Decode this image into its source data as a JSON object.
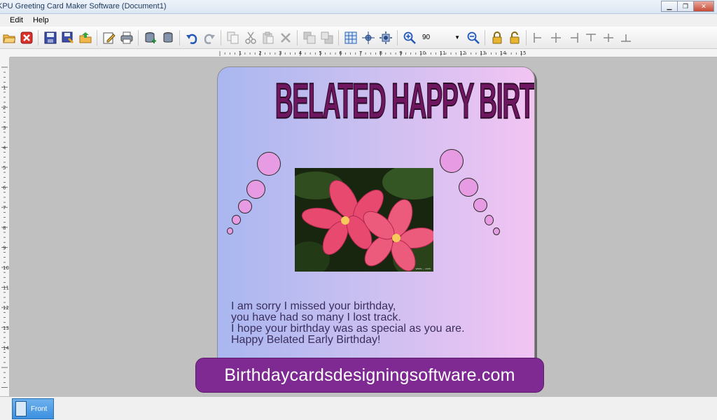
{
  "window": {
    "title": "KPU Greeting Card Maker Software  (Document1)"
  },
  "menu": {
    "items": [
      {
        "label": "Edit"
      },
      {
        "label": "Help"
      }
    ]
  },
  "toolbar": {
    "zoom_value": "90",
    "icons": [
      "open-folder-icon",
      "close-document-icon",
      "save-icon",
      "save-as-icon",
      "export-icon",
      "edit-icon",
      "print-icon",
      "database-add-icon",
      "database-icon",
      "undo-icon",
      "redo-icon",
      "copy-icon",
      "cut-icon",
      "paste-icon",
      "delete-icon",
      "bring-front-icon",
      "send-back-icon",
      "grid-icon",
      "center-icon",
      "move-icon",
      "zoom-in-icon",
      "zoom-out-icon",
      "lock-icon",
      "unlock-icon",
      "align-left-icon",
      "align-center-icon",
      "align-right-icon",
      "align-top-icon",
      "align-middle-icon",
      "align-bottom-icon"
    ]
  },
  "ruler": {
    "h_numbers": [
      "1",
      "2",
      "3",
      "4",
      "5",
      "6",
      "7",
      "8",
      "9",
      "10",
      "11",
      "12",
      "13",
      "14",
      "15"
    ],
    "v_numbers": [
      "1",
      "2",
      "3",
      "4",
      "5",
      "6",
      "7",
      "8",
      "9",
      "10",
      "11",
      "12",
      "13",
      "14"
    ]
  },
  "card": {
    "title": "BELATED HAPPY BIRTHDAY",
    "photo_caption": "flower-photo",
    "message_lines": [
      "I am sorry I missed your birthday,",
      "you have had so many I lost track.",
      "I hope your birthday was as special as you are.",
      "Happy Belated Early Birthday!"
    ],
    "colors": {
      "title": "#6e1760",
      "bubble": "#e69be2",
      "gradient_left": "#a9b7f0",
      "gradient_right": "#f2c4f2"
    }
  },
  "banner": {
    "text": "Birthdaycardsdesigningsoftware.com",
    "color": "#7e2a92"
  },
  "pages": {
    "tabs": [
      {
        "label": "Front"
      }
    ]
  }
}
